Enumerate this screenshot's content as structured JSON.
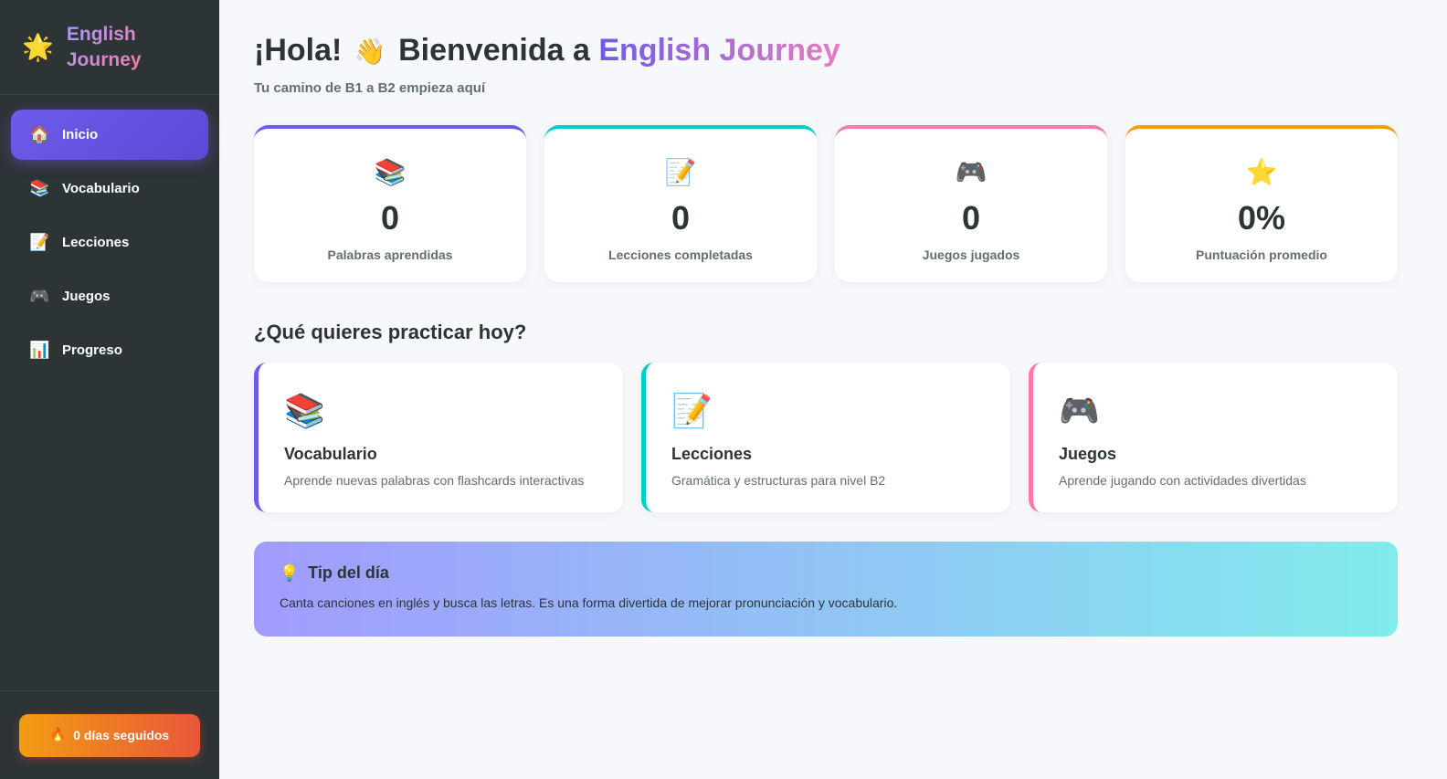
{
  "sidebar": {
    "brand_icon": "🌟",
    "brand_line1": "English",
    "brand_line2": "Journey",
    "items": [
      {
        "icon": "🏠",
        "label": "Inicio",
        "active": true
      },
      {
        "icon": "📚",
        "label": "Vocabulario"
      },
      {
        "icon": "📝",
        "label": "Lecciones"
      },
      {
        "icon": "🎮",
        "label": "Juegos"
      },
      {
        "icon": "📊",
        "label": "Progreso"
      }
    ],
    "streak": {
      "icon": "🔥",
      "label": "0 días seguidos"
    }
  },
  "header": {
    "greeting_prefix": "¡Hola!",
    "wave": "👋",
    "greeting_middle": "Bienvenida a",
    "brand": "English Journey",
    "subtitle": "Tu camino de B1 a B2 empieza aquí"
  },
  "stats": [
    {
      "icon": "📚",
      "value": "0",
      "label": "Palabras aprendidas",
      "color": "#6c5ce7"
    },
    {
      "icon": "📝",
      "value": "0",
      "label": "Lecciones completadas",
      "color": "#00cec9"
    },
    {
      "icon": "🎮",
      "value": "0",
      "label": "Juegos jugados",
      "color": "#fd79a8"
    },
    {
      "icon": "⭐",
      "value": "0%",
      "label": "Puntuación promedio",
      "color": "#f39c12"
    }
  ],
  "practice": {
    "title": "¿Qué quieres practicar hoy?",
    "cards": [
      {
        "icon": "📚",
        "title": "Vocabulario",
        "desc": "Aprende nuevas palabras con flashcards interactivas",
        "color": "#6c5ce7"
      },
      {
        "icon": "📝",
        "title": "Lecciones",
        "desc": "Gramática y estructuras para nivel B2",
        "color": "#00cec9"
      },
      {
        "icon": "🎮",
        "title": "Juegos",
        "desc": "Aprende jugando con actividades divertidas",
        "color": "#fd79a8"
      }
    ]
  },
  "tip": {
    "icon": "💡",
    "title": "Tip del día",
    "text": "Canta canciones en inglés y busca las letras. Es una forma divertida de mejorar pronunciación y vocabulario."
  }
}
